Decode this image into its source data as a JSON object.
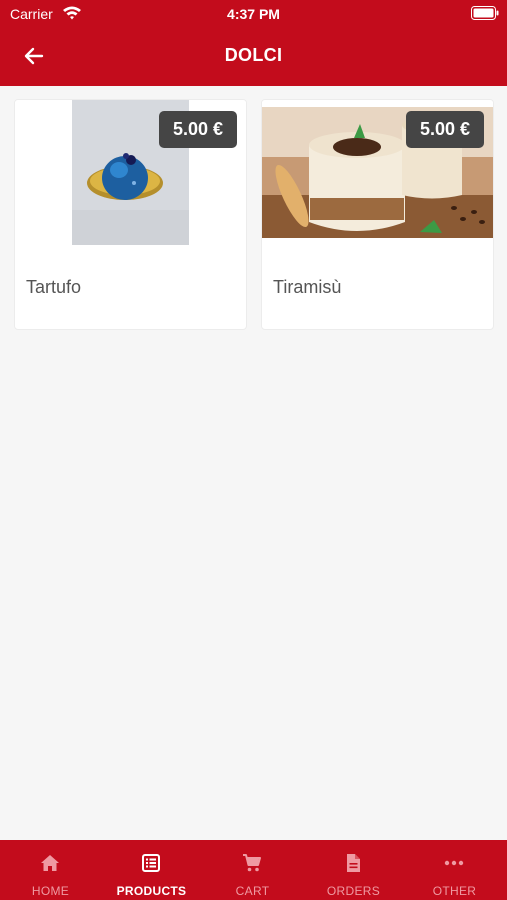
{
  "status": {
    "carrier": "Carrier",
    "time": "4:37 PM"
  },
  "header": {
    "title": "DOLCI",
    "back_icon": "arrow-left-icon"
  },
  "products": [
    {
      "name": "Tartufo",
      "price": "5.00 €"
    },
    {
      "name": "Tiramisù",
      "price": "5.00 €"
    }
  ],
  "tabs": [
    {
      "label": "HOME",
      "icon": "home-icon",
      "active": false
    },
    {
      "label": "PRODUCTS",
      "icon": "list-icon",
      "active": true
    },
    {
      "label": "CART",
      "icon": "cart-icon",
      "active": false
    },
    {
      "label": "ORDERS",
      "icon": "document-icon",
      "active": false
    },
    {
      "label": "OTHER",
      "icon": "more-icon",
      "active": false
    }
  ],
  "colors": {
    "brand": "#c30c1c",
    "price_badge": "#454545",
    "background": "#f6f6f6"
  }
}
